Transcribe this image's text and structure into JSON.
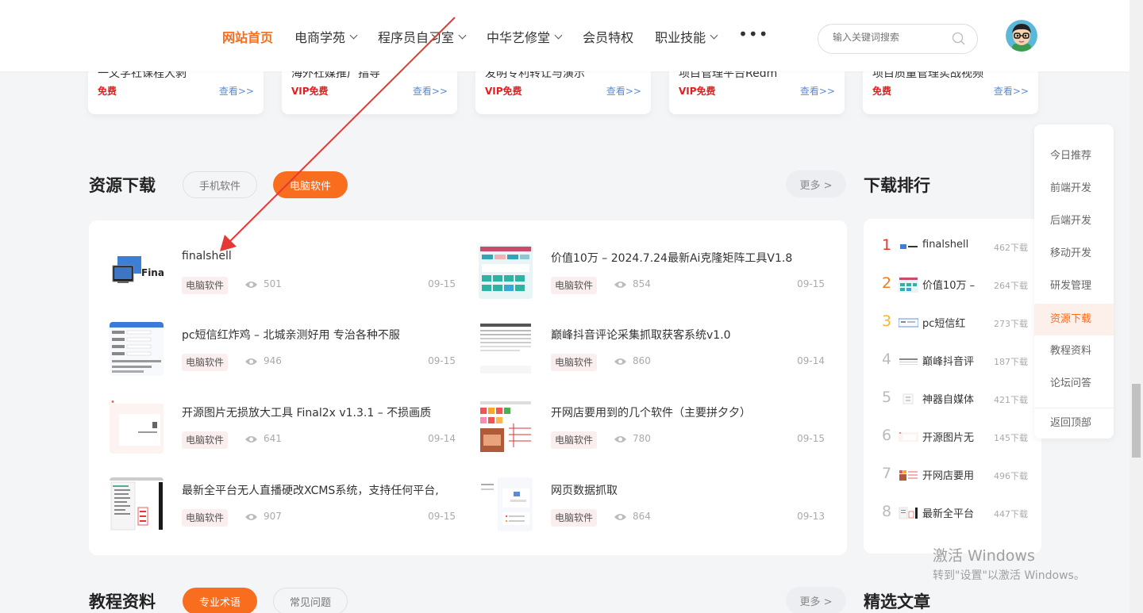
{
  "nav": {
    "items": [
      {
        "label": "网站首页",
        "dropdown": false,
        "active": true
      },
      {
        "label": "电商学苑",
        "dropdown": true
      },
      {
        "label": "程序员自习室",
        "dropdown": true
      },
      {
        "label": "中华艺修堂",
        "dropdown": true
      },
      {
        "label": "会员特权",
        "dropdown": false
      },
      {
        "label": "职业技能",
        "dropdown": true
      }
    ],
    "more": "•••",
    "search_placeholder": "输入关键词搜索"
  },
  "top_cards": [
    {
      "title": "一文学社课程大剥",
      "price": "免费",
      "link": "查看>>"
    },
    {
      "title": "海外社媒推广指导",
      "price": "VIP免费",
      "link": "查看>>"
    },
    {
      "title": "发明专利转让与演示",
      "price": "VIP免费",
      "link": "查看>>"
    },
    {
      "title": "项目管理平台Redm",
      "price": "VIP免费",
      "link": "查看>>"
    },
    {
      "title": "项目质量管理实战视频",
      "price": "免费",
      "link": "查看>>"
    }
  ],
  "resource": {
    "title": "资源下载",
    "tabs": [
      "手机软件",
      "电脑软件"
    ],
    "active_tab": 1,
    "more": "更多 >",
    "items": [
      {
        "title": "finalshell",
        "tag": "电脑软件",
        "views": "501",
        "date": "09-15"
      },
      {
        "title": "价值10万 – 2024.7.24最新Ai克隆矩阵工具V1.8",
        "tag": "电脑软件",
        "views": "854",
        "date": "09-15"
      },
      {
        "title": "pc短信红炸鸡 – 北城亲测好用 专治各种不服",
        "tag": "电脑软件",
        "views": "946",
        "date": "09-15"
      },
      {
        "title": "巅峰抖音评论采集抓取获客系统v1.0",
        "tag": "电脑软件",
        "views": "860",
        "date": "09-14"
      },
      {
        "title": "开源图片无损放大工具 Final2x v1.3.1 – 不损画质",
        "tag": "电脑软件",
        "views": "641",
        "date": "09-14"
      },
      {
        "title": "开网店要用到的几个软件（主要拼夕夕）",
        "tag": "电脑软件",
        "views": "780",
        "date": "09-15"
      },
      {
        "title": "最新全平台无人直播硬改XCMS系统，支持任何平台,",
        "tag": "电脑软件",
        "views": "907",
        "date": "09-15"
      },
      {
        "title": "网页数据抓取",
        "tag": "电脑软件",
        "views": "864",
        "date": "09-13"
      }
    ]
  },
  "ranking": {
    "title": "下载排行",
    "items": [
      {
        "rank": "1",
        "title": "finalshell",
        "count": "462下载",
        "color": "#e8322a"
      },
      {
        "rank": "2",
        "title": "价值10万 –",
        "count": "264下载",
        "color": "#f07a1e"
      },
      {
        "rank": "3",
        "title": "pc短信红",
        "count": "273下载",
        "color": "#f5b731"
      },
      {
        "rank": "4",
        "title": "巅峰抖音评",
        "count": "187下载"
      },
      {
        "rank": "5",
        "title": "神器自媒体",
        "count": "421下载"
      },
      {
        "rank": "6",
        "title": "开源图片无",
        "count": "145下载"
      },
      {
        "rank": "7",
        "title": "开网店要用",
        "count": "496下载"
      },
      {
        "rank": "8",
        "title": "最新全平台",
        "count": "447下载"
      }
    ]
  },
  "sidenav": {
    "items": [
      "今日推荐",
      "前端开发",
      "后端开发",
      "移动开发",
      "研发管理",
      "资源下载",
      "教程资料",
      "论坛问答"
    ],
    "active": 5,
    "back_top": "返回顶部"
  },
  "tutorial": {
    "title": "教程资料",
    "tabs": [
      "专业术语",
      "常见问题"
    ],
    "more": "更多 >"
  },
  "featured": {
    "title": "精选文章"
  },
  "thumb_logo_text": "Fina",
  "watermark": {
    "line1": "激活 Windows",
    "line2": "转到\"设置\"以激活 Windows。"
  },
  "colors": {
    "accent": "#f96d1f",
    "price_red": "#e02020",
    "link_blue": "#5b8ad8",
    "annotation_arrow": "#e53935"
  }
}
